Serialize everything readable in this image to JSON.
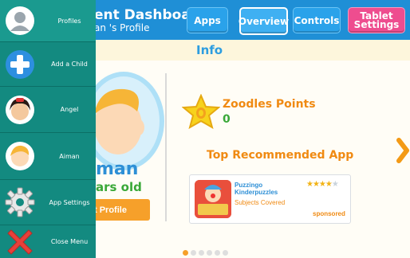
{
  "header": {
    "title": "ent Dashboard",
    "subtitle": "an 's Profile",
    "buttons": [
      {
        "label": "Apps"
      },
      {
        "label": "Overview"
      },
      {
        "label": "Controls"
      },
      {
        "label_line1": "Tablet",
        "label_line2": "Settings"
      }
    ]
  },
  "info_title": "Info",
  "profile": {
    "name": "man",
    "age": "ars old",
    "edit_label": "t Profile"
  },
  "points": {
    "label": "Zoodles Points",
    "value": "0"
  },
  "recommended": {
    "title": "Top Recommended App",
    "app_name": "Puzzingo Kinderpuzzles",
    "app_subtitle": "Subjects Covered",
    "sponsored": "sponsored",
    "rating": 4,
    "rating_max": 5
  },
  "menu": {
    "items": [
      {
        "label": "Profiles",
        "icon": "profile-silhouette-icon"
      },
      {
        "label": "Add a Child",
        "icon": "plus-icon"
      },
      {
        "label": "Angel",
        "icon": "girl-avatar-icon"
      },
      {
        "label": "Aiman",
        "icon": "boy-avatar-icon"
      },
      {
        "label": "App Settings",
        "icon": "gear-icon"
      },
      {
        "label": "Close Menu",
        "icon": "close-icon"
      }
    ]
  },
  "pager": {
    "pages": 6,
    "current": 1
  },
  "colors": {
    "topbar": "#1f8fd6",
    "menu": "#138a80",
    "accent_orange": "#f6a02a",
    "tablet_settings": "#ee4d8f",
    "green_text": "#3aa838"
  }
}
